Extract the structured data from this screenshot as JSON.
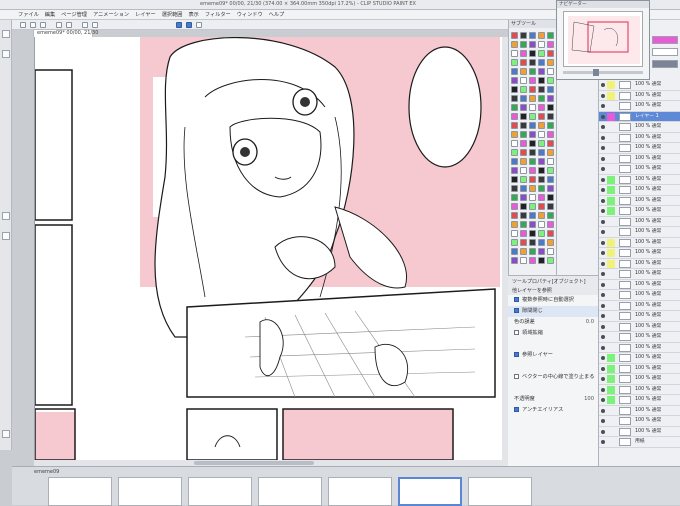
{
  "window": {
    "title": "ememe09* 00/00, 21/30 (374.00 × 364.00mm 350dpi 17.2%) - CLIP STUDIO PAINT EX"
  },
  "menu": [
    "ファイル",
    "編集",
    "ページ管理",
    "アニメーション",
    "レイヤー",
    "選択範囲",
    "表示",
    "フィルター",
    "ウィンドウ",
    "ヘルプ"
  ],
  "document": {
    "tab_label": "ememe09* 00/00, 21/30"
  },
  "page_strip": {
    "label": "ememe09"
  },
  "tool_panel": {
    "header": "サブツール"
  },
  "navigator": {
    "header": "ナビゲーター"
  },
  "property_panel": {
    "header": "ツールプロパティ[オブジェクト]",
    "subheader": "他レイヤーを参照",
    "rows": [
      {
        "label": "複数参照時に自動選択",
        "checked": true
      },
      {
        "label": "隙間閉じ",
        "checked": true
      },
      {
        "label": "色の誤差",
        "value": "0.0"
      },
      {
        "label": "領域拡縮",
        "checked": false
      },
      {
        "label": "",
        "value": ""
      },
      {
        "label": "参照レイヤー",
        "checked": true
      },
      {
        "label": "",
        "value": ""
      },
      {
        "label": "ベクターの中心線で塗り止まる",
        "checked": false
      },
      {
        "label": "",
        "value": ""
      },
      {
        "label": "不透明度",
        "value": "100"
      },
      {
        "label": "アンチエイリアス",
        "checked": true
      }
    ]
  },
  "colors": {
    "accent": "#5a86d6",
    "pink": "#f5c9cf",
    "green": "#7df27a",
    "yellow": "#f1f27a",
    "magenta": "#e85ad6"
  },
  "layers": [
    {
      "name": "100 % 通常",
      "color": "#f1f27a",
      "selected": false
    },
    {
      "name": "100 % 通常",
      "color": "#f1f27a",
      "selected": false
    },
    {
      "name": "100 % 通常",
      "color": "",
      "selected": false
    },
    {
      "name": "レイヤー 1",
      "color": "#e85ad6",
      "selected": true
    },
    {
      "name": "100 % 通常",
      "color": "",
      "selected": false
    },
    {
      "name": "100 % 通常",
      "color": "",
      "selected": false
    },
    {
      "name": "100 % 通常",
      "color": "",
      "selected": false
    },
    {
      "name": "100 % 通常",
      "color": "",
      "selected": false
    },
    {
      "name": "100 % 通常",
      "color": "",
      "selected": false
    },
    {
      "name": "100 % 通常",
      "color": "#7df27a",
      "selected": false
    },
    {
      "name": "100 % 通常",
      "color": "#7df27a",
      "selected": false
    },
    {
      "name": "100 % 通常",
      "color": "#7df27a",
      "selected": false
    },
    {
      "name": "100 % 通常",
      "color": "#7df27a",
      "selected": false
    },
    {
      "name": "100 % 通常",
      "color": "",
      "selected": false
    },
    {
      "name": "100 % 通常",
      "color": "",
      "selected": false
    },
    {
      "name": "100 % 通常",
      "color": "#f1f27a",
      "selected": false
    },
    {
      "name": "100 % 通常",
      "color": "#f1f27a",
      "selected": false
    },
    {
      "name": "100 % 通常",
      "color": "#f1f27a",
      "selected": false
    },
    {
      "name": "100 % 通常",
      "color": "",
      "selected": false
    },
    {
      "name": "100 % 通常",
      "color": "",
      "selected": false
    },
    {
      "name": "100 % 通常",
      "color": "",
      "selected": false
    },
    {
      "name": "100 % 通常",
      "color": "",
      "selected": false
    },
    {
      "name": "100 % 通常",
      "color": "",
      "selected": false
    },
    {
      "name": "100 % 通常",
      "color": "",
      "selected": false
    },
    {
      "name": "100 % 通常",
      "color": "",
      "selected": false
    },
    {
      "name": "100 % 通常",
      "color": "",
      "selected": false
    },
    {
      "name": "100 % 通常",
      "color": "#7df27a",
      "selected": false
    },
    {
      "name": "100 % 通常",
      "color": "#7df27a",
      "selected": false
    },
    {
      "name": "100 % 通常",
      "color": "#7df27a",
      "selected": false
    },
    {
      "name": "100 % 通常",
      "color": "#7df27a",
      "selected": false
    },
    {
      "name": "100 % 通常",
      "color": "#7df27a",
      "selected": false
    },
    {
      "name": "100 % 通常",
      "color": "",
      "selected": false
    },
    {
      "name": "100 % 通常",
      "color": "",
      "selected": false
    },
    {
      "name": "100 % 通常",
      "color": "",
      "selected": false
    },
    {
      "name": "用紙",
      "color": "",
      "selected": false
    }
  ]
}
